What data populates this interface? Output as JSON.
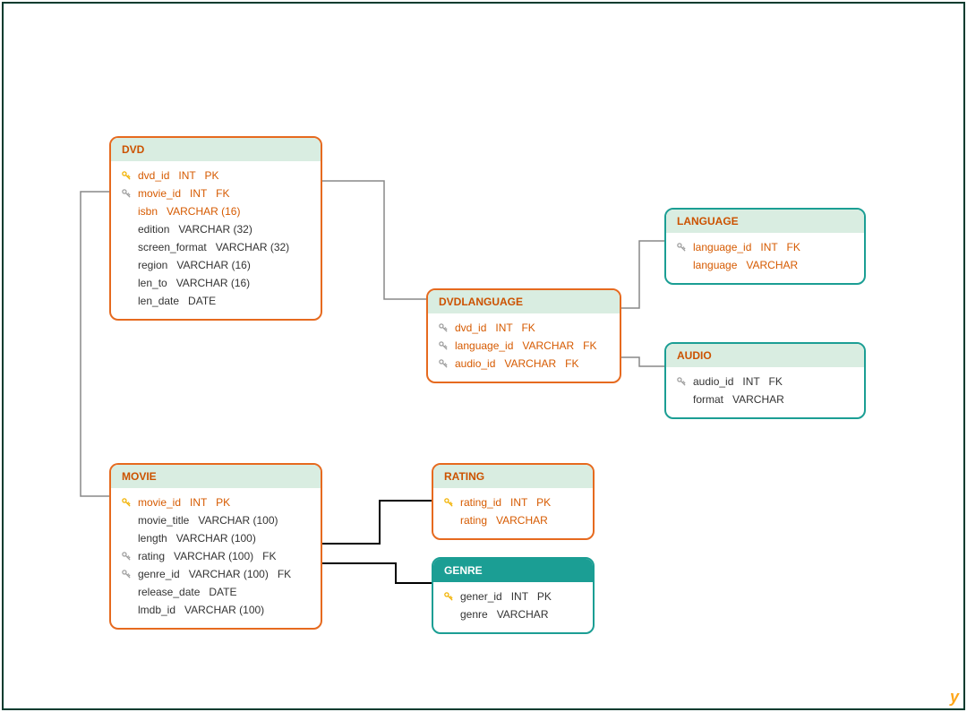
{
  "entities": {
    "dvd": {
      "title": "DVD",
      "rows": [
        {
          "key": "pk",
          "name": "dvd_id",
          "type": "INT",
          "constraint": "PK",
          "hl": true
        },
        {
          "key": "fk",
          "name": "movie_id",
          "type": "INT",
          "constraint": "FK",
          "hl": true
        },
        {
          "key": "",
          "name": "isbn",
          "type": "VARCHAR (16)",
          "constraint": "",
          "hl": true
        },
        {
          "key": "",
          "name": "edition",
          "type": "VARCHAR (32)",
          "constraint": "",
          "hl": false
        },
        {
          "key": "",
          "name": "screen_format",
          "type": "VARCHAR (32)",
          "constraint": "",
          "hl": false
        },
        {
          "key": "",
          "name": "region",
          "type": "VARCHAR (16)",
          "constraint": "",
          "hl": false
        },
        {
          "key": "",
          "name": "len_to",
          "type": "VARCHAR (16)",
          "constraint": "",
          "hl": false
        },
        {
          "key": "",
          "name": "len_date",
          "type": "DATE",
          "constraint": "",
          "hl": false
        }
      ]
    },
    "dvdlanguage": {
      "title": "DVDLANGUAGE",
      "rows": [
        {
          "key": "fk",
          "name": "dvd_id",
          "type": "INT",
          "constraint": "FK",
          "hl": true
        },
        {
          "key": "fk",
          "name": "language_id",
          "type": "VARCHAR",
          "constraint": "FK",
          "hl": true
        },
        {
          "key": "fk",
          "name": "audio_id",
          "type": "VARCHAR",
          "constraint": "FK",
          "hl": true
        }
      ]
    },
    "language": {
      "title": "LANGUAGE",
      "rows": [
        {
          "key": "fk",
          "name": "language_id",
          "type": "INT",
          "constraint": "FK",
          "hl": true
        },
        {
          "key": "",
          "name": "language",
          "type": "VARCHAR",
          "constraint": "",
          "hl": true
        }
      ]
    },
    "audio": {
      "title": "AUDIO",
      "rows": [
        {
          "key": "fk",
          "name": "audio_id",
          "type": "INT",
          "constraint": "FK",
          "hl": false
        },
        {
          "key": "",
          "name": "format",
          "type": "VARCHAR",
          "constraint": "",
          "hl": false
        }
      ]
    },
    "movie": {
      "title": "MOVIE",
      "rows": [
        {
          "key": "pk",
          "name": "movie_id",
          "type": "INT",
          "constraint": "PK",
          "hl": true
        },
        {
          "key": "",
          "name": "movie_title",
          "type": "VARCHAR (100)",
          "constraint": "",
          "hl": false
        },
        {
          "key": "",
          "name": "length",
          "type": "VARCHAR (100)",
          "constraint": "",
          "hl": false
        },
        {
          "key": "fk",
          "name": "rating",
          "type": "VARCHAR (100)",
          "constraint": "FK",
          "hl": false
        },
        {
          "key": "fk",
          "name": "genre_id",
          "type": "VARCHAR (100)",
          "constraint": "FK",
          "hl": false
        },
        {
          "key": "",
          "name": "release_date",
          "type": "DATE",
          "constraint": "",
          "hl": false
        },
        {
          "key": "",
          "name": "lmdb_id",
          "type": "VARCHAR (100)",
          "constraint": "",
          "hl": false
        }
      ]
    },
    "rating": {
      "title": "RATING",
      "rows": [
        {
          "key": "pk",
          "name": "rating_id",
          "type": "INT",
          "constraint": "PK",
          "hl": true
        },
        {
          "key": "",
          "name": "rating",
          "type": "VARCHAR",
          "constraint": "",
          "hl": true
        }
      ]
    },
    "genre": {
      "title": "GENRE",
      "rows": [
        {
          "key": "pk",
          "name": "gener_id",
          "type": "INT",
          "constraint": "PK",
          "hl": false
        },
        {
          "key": "",
          "name": "genre",
          "type": "VARCHAR",
          "constraint": "",
          "hl": false
        }
      ]
    }
  },
  "watermark": "y"
}
